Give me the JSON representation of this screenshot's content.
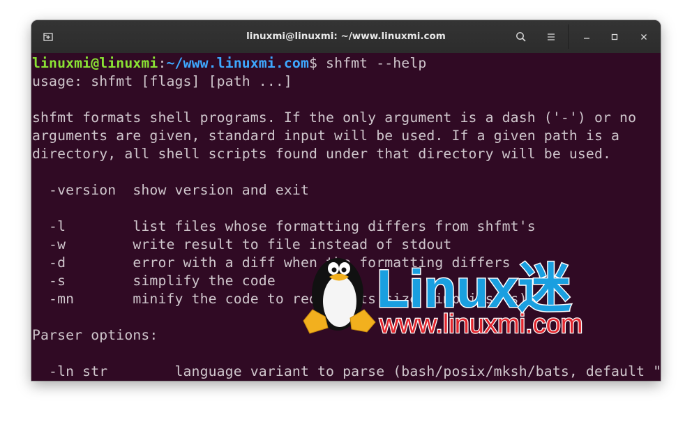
{
  "window": {
    "title": "linuxmi@linuxmi: ~/www.linuxmi.com",
    "icons": {
      "new_tab": "new-tab-icon",
      "search": "search-icon",
      "menu": "hamburger-menu-icon",
      "minimize": "minimize-icon",
      "maximize": "maximize-icon",
      "close": "close-icon"
    }
  },
  "colors": {
    "terminal_bg": "#300a24",
    "text": "#cfc6cc",
    "prompt_user": "#8ae234",
    "prompt_path": "#3ea8ff",
    "watermark_blue": "#1a9fe0",
    "watermark_red": "#e3262e"
  },
  "terminal": {
    "prompt": {
      "user_host": "linuxmi@linuxmi",
      "colon": ":",
      "path": "~/www.linuxmi.com",
      "symbol": "$",
      "command": " shfmt --help"
    },
    "lines": [
      "usage: shfmt [flags] [path ...]",
      "",
      "shfmt formats shell programs. If the only argument is a dash ('-') or no",
      "arguments are given, standard input will be used. If a given path is a",
      "directory, all shell scripts found under that directory will be used.",
      "",
      "  -version  show version and exit",
      "",
      "  -l        list files whose formatting differs from shfmt's",
      "  -w        write result to file instead of stdout",
      "  -d        error with a diff when the formatting differs",
      "  -s        simplify the code",
      "  -mn       minify the code to reduce its size (implies -s)",
      "",
      "Parser options:",
      "",
      "  -ln str        language variant to parse (bash/posix/mksh/bats, default \""
    ]
  },
  "watermark": {
    "logo_text": "Linux迷",
    "url": "www.linuxmi.com"
  }
}
